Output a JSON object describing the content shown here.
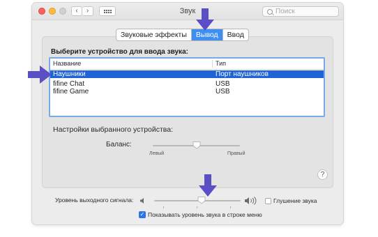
{
  "window": {
    "title": "Звук"
  },
  "toolbar": {
    "back_icon": "chevron-left-icon",
    "forward_icon": "chevron-right-icon",
    "grid_icon": "show-all-grid-icon",
    "search_placeholder": "Поиск"
  },
  "tabs": [
    {
      "label": "Звуковые эффекты",
      "active": false
    },
    {
      "label": "Вывод",
      "active": true
    },
    {
      "label": "Ввод",
      "active": false
    }
  ],
  "output": {
    "section_label": "Выберите устройство для ввода звука:",
    "columns": [
      "Название",
      "Тип"
    ],
    "devices": [
      {
        "name": "Наушники",
        "type": "Порт наушников",
        "selected": true
      },
      {
        "name": "fifine Chat",
        "type": "USB",
        "selected": false
      },
      {
        "name": "fifine Game",
        "type": "USB",
        "selected": false
      }
    ],
    "settings_label": "Настройки выбранного устройства:",
    "balance": {
      "label": "Баланс:",
      "left_label": "Левый",
      "right_label": "Правый",
      "value": 0.5
    }
  },
  "help_label": "?",
  "volume": {
    "label": "Уровень выходного сигнала:",
    "level": 0.55,
    "mute_label": "Глушение звука",
    "mute_checked": false,
    "show_in_menu_label": "Показывать уровень звука в строке меню",
    "show_in_menu_checked": true
  },
  "annotations": {
    "arrow_color": "#5a4fc4"
  },
  "colors": {
    "accent": "#3f8ef3",
    "selection": "#1f63d6"
  }
}
